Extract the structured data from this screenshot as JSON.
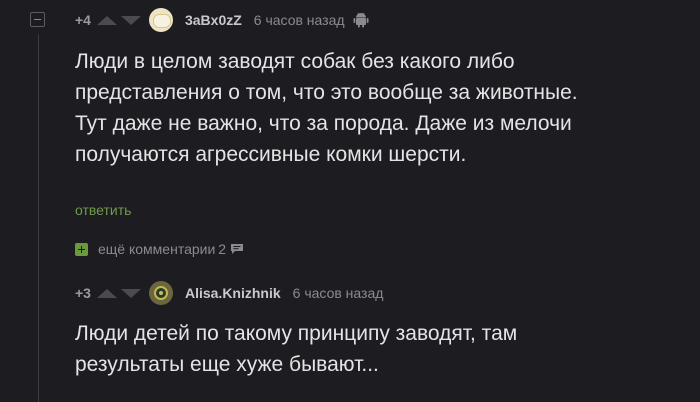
{
  "comments": [
    {
      "rating": "+4",
      "username": "3aBx0zZ",
      "time": "6 часов назад",
      "text_lines": [
        "Люди в целом заводят собак без какого либо",
        "представления о том, что это вообще за животные.",
        "Тут даже не важно, что за порода. Даже из мелочи",
        "получаются агрессивные комки шерсти."
      ],
      "reply_label": "ответить",
      "platform_icon": "android-icon"
    },
    {
      "rating": "+3",
      "username": "Alisa.Knizhnik",
      "time": "6 часов назад",
      "text_lines": [
        "Люди детей по такому принципу заводят, там",
        "результаты еще хуже бывают..."
      ]
    }
  ],
  "more_comments": {
    "label": "ещё комментарии",
    "count": "2"
  },
  "colors": {
    "background": "#1d1d21",
    "reply": "#6f9a4a",
    "plus": "#6a9a3d"
  }
}
